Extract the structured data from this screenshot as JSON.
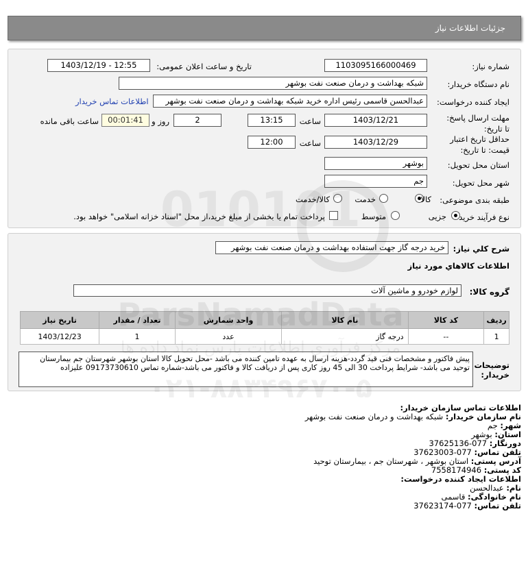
{
  "header": {
    "title": "جزئیات اطلاعات نیاز"
  },
  "form": {
    "need_number_label": "شماره نیاز:",
    "need_number": "1103095166000469",
    "announce_label": "تاریخ و ساعت اعلان عمومی:",
    "announce_value": "1403/12/19 - 12:55",
    "buyer_label": "نام دستگاه خریدار:",
    "buyer_value": "شبکه بهداشت و درمان صنعت نفت بوشهر",
    "creator_label": "ایجاد کننده درخواست:",
    "creator_value": "عبدالحسن قاسمی رئیس اداره خرید  شبکه بهداشت و درمان صنعت نفت بوشهر",
    "contact_link": "اطلاعات تماس خریدار",
    "deadline_label": "مهلت ارسال پاسخ: تا تاریخ:",
    "deadline_date": "1403/12/21",
    "time_label": "ساعت",
    "deadline_time": "13:15",
    "days_value": "2",
    "days_label": "روز و",
    "remaining_value": "00:01:41",
    "remaining_label": "ساعت باقی مانده",
    "validity_label": "حداقل تاریخ اعتبار قیمت: تا تاریخ:",
    "validity_date": "1403/12/29",
    "validity_time": "12:00",
    "province_label": "استان محل تحویل:",
    "province_value": "بوشهر",
    "city_label": "شهر محل تحویل:",
    "city_value": "جم",
    "category_label": "طبقه بندی موضوعی:",
    "category_options": [
      "کالا",
      "خدمت",
      "کالا/خدمت"
    ],
    "category_selected": "کالا",
    "process_label": "نوع فرآیند خرید :",
    "process_options": [
      "جزیی",
      "متوسط"
    ],
    "process_selected": "جزیی",
    "payment_note": "پرداخت تمام یا بخشی از مبلغ خرید،از محل \"اسناد خزانه اسلامی\" خواهد بود."
  },
  "need": {
    "summary_label": "شرح کلي نياز:",
    "summary_value": "خرید درجه گاز جهت استفاده بهداشت و درمان صنعت نفت بوشهر",
    "goods_info_title": "اطلاعات کالاهاي مورد نياز",
    "group_label": "گروه کالا:",
    "group_value": "لوازم خودرو و ماشین آلات",
    "table": {
      "headers": [
        "ردیف",
        "کد کالا",
        "نام کالا",
        "واحد شمارش",
        "تعداد / مقدار",
        "تاریخ نیاز"
      ],
      "rows": [
        [
          "1",
          "--",
          "درجه گاز",
          "عدد",
          "1",
          "1403/12/23"
        ]
      ]
    },
    "buyer_notes_label": "توضیحات خریدار:",
    "buyer_notes": "پیش فاکتور و مشخصات فنی قید گردد-هزینه ارسال به عهده تامین کننده می باشد -محل تحویل کالا استان بوشهر شهرستان جم بیمارستان توحید می باشد- شرایط پرداخت 30 الی 45 روز کاری پس از دریافت کالا و فاکتور می باشد-شماره تماس 09173730610 علیزاده"
  },
  "contact": {
    "title": "اطلاعات تماس سازمان خریدار:",
    "org_label": "نام سازمان خریدار:",
    "org_value": "شبکه بهداشت و درمان صنعت نفت بوشهر",
    "city_label": "شهر:",
    "city_value": "جم",
    "province_label": "استان:",
    "province_value": "بوشهر",
    "fax_label": "دورنگار:",
    "fax_value": "077-37625136",
    "phone_label": "تلفن تماس:",
    "phone_value": "077-37623003",
    "address_label": "آدرس پستی:",
    "address_value": "استان بوشهر ، شهرستان جم ، بیمارستان توحید",
    "postal_label": "کد پستی:",
    "postal_value": "7558174946",
    "creator_title": "اطلاعات ایجاد کننده درخواست:",
    "name_label": "نام:",
    "name_value": "عبدالحسن",
    "family_label": "نام خانوادگی:",
    "family_value": "قاسمی",
    "creator_phone_label": "تلفن تماس:",
    "creator_phone_value": "077-37623174"
  },
  "watermark": {
    "brand": "ParsNamadData",
    "persian": "مرکز فرآوری اطلاعات پارس نماد داده ها",
    "phone": "۰۲۱-۸۸۳۴۹۶۷۰-۵"
  }
}
